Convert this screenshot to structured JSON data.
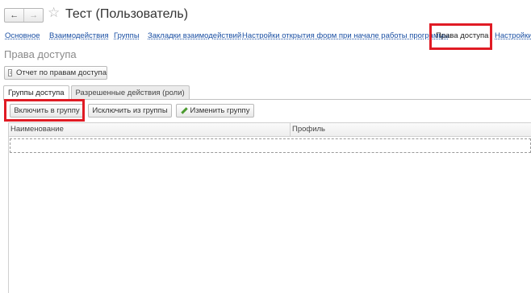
{
  "window": {
    "title": "Тест (Пользователь)",
    "back_icon": "arrow-left-icon",
    "forward_icon": "arrow-right-icon",
    "favorite_icon": "star-outline-icon"
  },
  "sections": [
    {
      "label": "Основное"
    },
    {
      "label": "Взаимодействия"
    },
    {
      "label": "Группы"
    },
    {
      "label": "Закладки взаимодействий"
    },
    {
      "label": "Настройки открытия форм при начале работы программы"
    },
    {
      "label": "Права доступа",
      "active": true
    },
    {
      "label": "Настройки"
    }
  ],
  "page": {
    "title": "Права доступа",
    "report_button": "Отчет по правам доступа"
  },
  "tabs": [
    {
      "label": "Группы доступа",
      "active": true
    },
    {
      "label": "Разрешенные действия (роли)",
      "active": false
    }
  ],
  "toolbar": {
    "include_button": "Включить в группу",
    "exclude_button": "Исключить из группы",
    "edit_button": "Изменить группу"
  },
  "table": {
    "columns": [
      "Наименование",
      "Профиль"
    ]
  },
  "colors": {
    "highlight": "#e01b24",
    "link": "#1a4fa3"
  }
}
